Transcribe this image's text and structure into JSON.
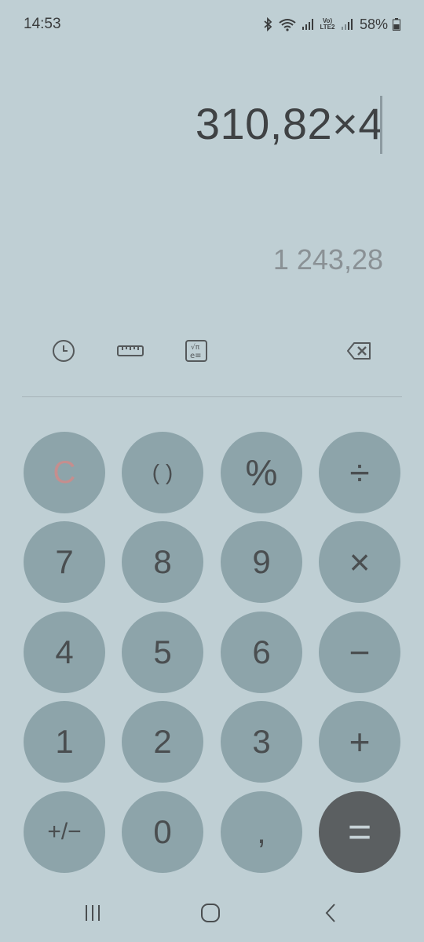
{
  "status_bar": {
    "time": "14:53",
    "network_label": "Vo) LTE2",
    "battery": "58%",
    "icons": [
      "bluetooth-icon",
      "wifi-icon",
      "signal-icon",
      "signal-icon",
      "battery-icon"
    ]
  },
  "display": {
    "expression": "310,82×4",
    "result": "1 243,28"
  },
  "toolbar": {
    "icons": [
      "history-icon",
      "ruler-icon",
      "scientific-icon",
      "backspace-icon"
    ]
  },
  "keys": {
    "clear": "C",
    "parentheses": "( )",
    "percent": "%",
    "divide": "÷",
    "seven": "7",
    "eight": "8",
    "nine": "9",
    "multiply": "×",
    "four": "4",
    "five": "5",
    "six": "6",
    "minus": "−",
    "one": "1",
    "two": "2",
    "three": "3",
    "plus": "+",
    "plus_minus": "+/−",
    "zero": "0",
    "decimal": ",",
    "equals": "="
  },
  "colors": {
    "background": "#bfcfd4",
    "key": "#8da4aa",
    "equals_key": "#5b5f61",
    "clear_text": "#c58e8e"
  },
  "nav_bar": {
    "icons": [
      "recents-icon",
      "home-icon",
      "back-icon"
    ]
  }
}
